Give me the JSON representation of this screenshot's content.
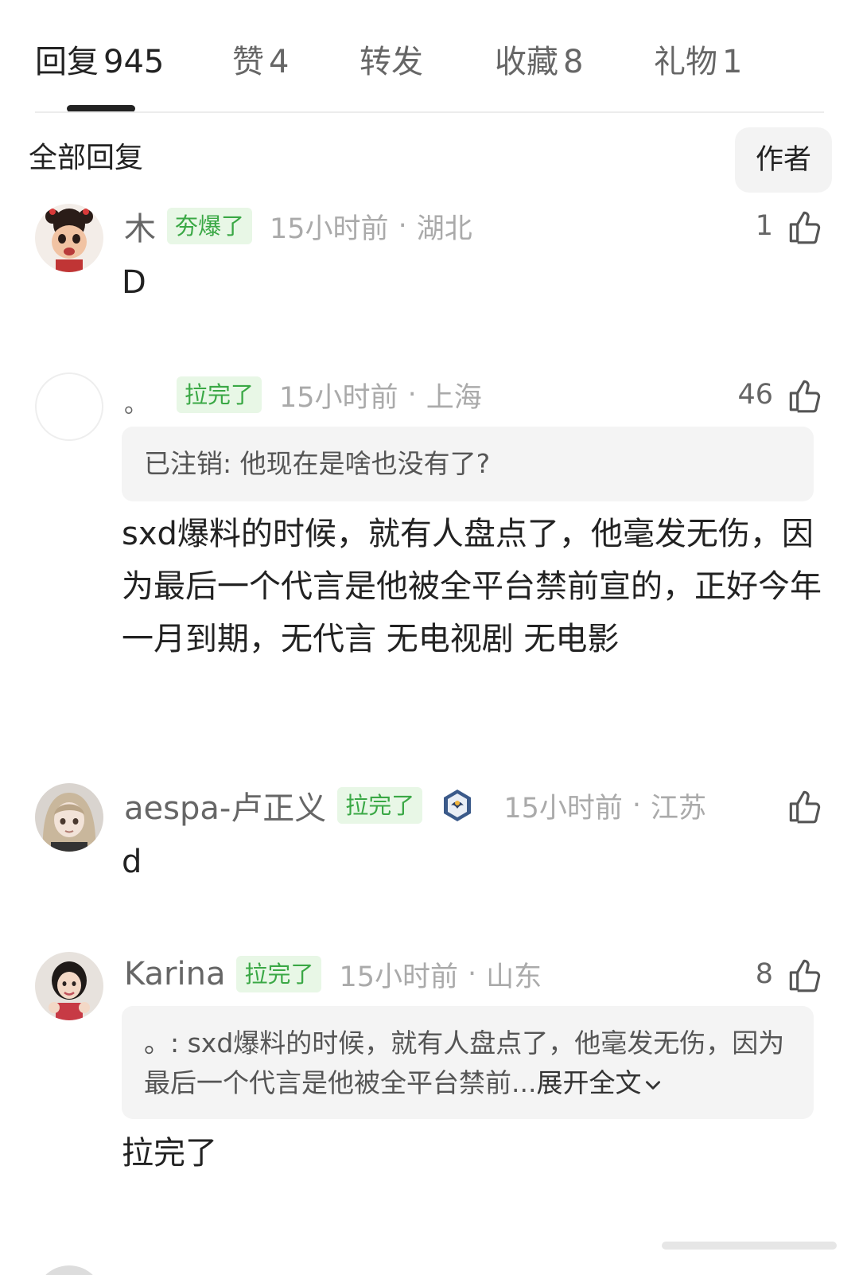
{
  "tabs": [
    {
      "label": "回复",
      "count": "945"
    },
    {
      "label": "赞",
      "count": "4"
    },
    {
      "label": "转发",
      "count": ""
    },
    {
      "label": "收藏",
      "count": "8"
    },
    {
      "label": "礼物",
      "count": "1"
    }
  ],
  "filter": {
    "title": "全部回复",
    "author_button": "作者"
  },
  "comments": [
    {
      "username": "木",
      "badge": "夯爆了",
      "time": "15小时前",
      "separator": "·",
      "location": "湖北",
      "likes": "1",
      "text": "D",
      "avatar_icon": "cartoon-girl-avatar"
    },
    {
      "username": "。",
      "badge": "拉完了",
      "time": "15小时前",
      "separator": "·",
      "location": "上海",
      "likes": "46",
      "quote": "已注销: 他现在是啥也没有了?",
      "text": "sxd爆料的时候，就有人盘点了，他毫发无伤，因为最后一个代言是他被全平台禁前宣的，正好今年一月到期，无代言 无电视剧 无电影",
      "avatar_icon": "blank-avatar"
    },
    {
      "username": "aespa-卢正义",
      "badge": "拉完了",
      "medal_icon": "eagle-medal-icon",
      "time": "15小时前",
      "separator": "·",
      "location": "江苏",
      "likes": "",
      "text": "d",
      "avatar_icon": "anime-girl-avatar"
    },
    {
      "username": "Karina",
      "badge": "拉完了",
      "time": "15小时前",
      "separator": "·",
      "location": "山东",
      "likes": "8",
      "quote_prefix": "。: sxd爆料的时候，就有人盘点了，他毫发无伤，因为最后一个代言是他被全平台禁前...",
      "quote_expand": "展开全文",
      "text": "拉完了",
      "avatar_icon": "photo-avatar"
    }
  ],
  "colors": {
    "badge_text": "#3aa845",
    "badge_bg": "#e8f7e6",
    "meta_gray": "#aaaaaa",
    "quote_bg": "#f4f4f4"
  }
}
